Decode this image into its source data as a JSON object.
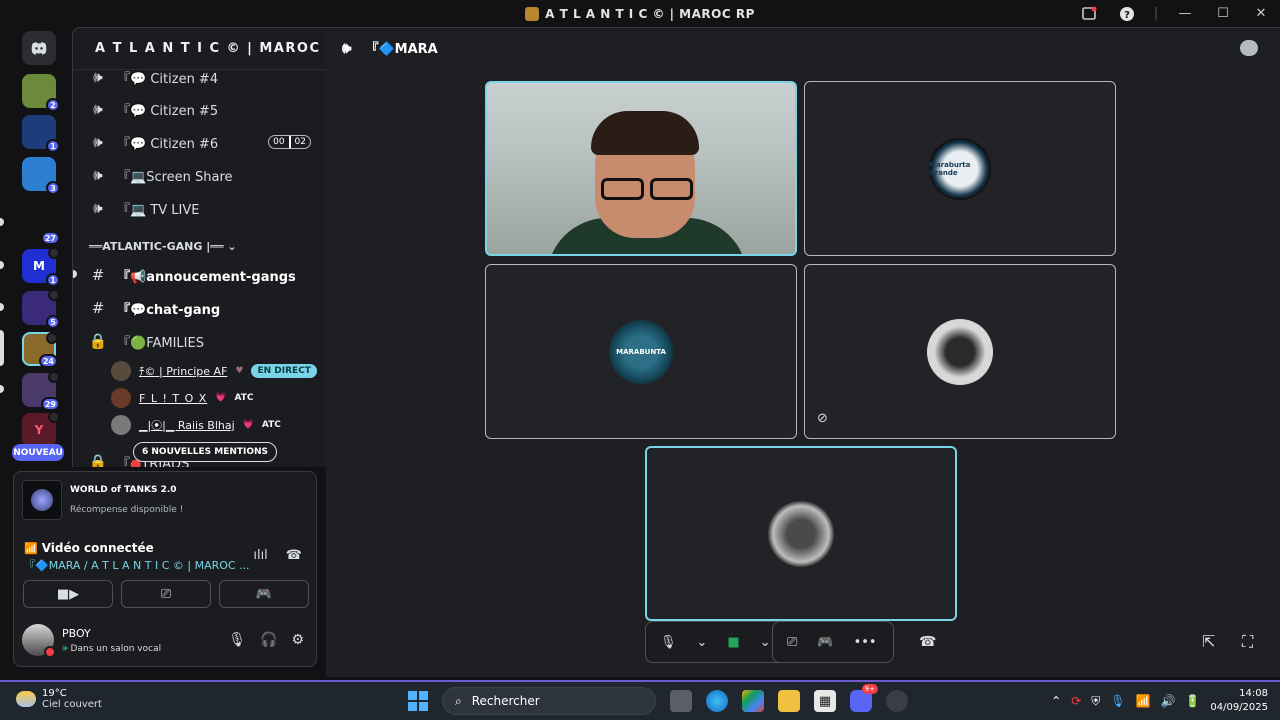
{
  "window": {
    "title": "A T L A N T I C © | MAROC RP"
  },
  "rail": {
    "servers": [
      {
        "badge": ""
      },
      {
        "badge": "2"
      },
      {
        "badge": "1"
      },
      {
        "badge": "3"
      },
      {
        "badge": "27"
      },
      {
        "badge": "1"
      },
      {
        "badge": "5"
      },
      {
        "badge": "24"
      },
      {
        "badge": "29"
      },
      {
        "badge": ""
      }
    ],
    "new_label": "NOUVEAU"
  },
  "guild": {
    "name": "A T L A N T I C © | MAROC RP"
  },
  "channels": [
    {
      "prefix": "『",
      "name": "Citizen #4",
      "icon": "💬"
    },
    {
      "prefix": "『",
      "name": "Citizen #5",
      "icon": "💬"
    },
    {
      "prefix": "『",
      "name": "Citizen #6",
      "icon": "💬",
      "usage": [
        "00",
        "02"
      ]
    },
    {
      "prefix": "『",
      "name": "Screen Share",
      "icon": "💻"
    },
    {
      "prefix": "『",
      "name": "TV LIVE",
      "icon": "💻"
    }
  ],
  "category": "══ATLANTIC-GANG |══ ⌄",
  "gang_channels": [
    {
      "prefix": "『",
      "name": "annoucement-gangs",
      "icon": "📢"
    },
    {
      "prefix": "『",
      "name": "chat-gang",
      "icon": "💬"
    },
    {
      "prefix": "『",
      "name": "FAMILIES",
      "icon": "🟢"
    }
  ],
  "members": [
    {
      "name": "ﾁ© | Principe AF",
      "extra": "",
      "live": "EN DIRECT"
    },
    {
      "name": "F L ! T O X",
      "extra": "ATC",
      "live": ""
    },
    {
      "name": "▁|⦿|▁ Raiis Blhaj",
      "extra": "ATC",
      "live": ""
    }
  ],
  "triads_channel": {
    "prefix": "『",
    "name": "TRIADS"
  },
  "mentions": "6 NOUVELLES MENTIONS",
  "promo": {
    "title": "WORLD of TANKS 2.0",
    "subtitle": "Récompense disponible !"
  },
  "voice": {
    "status": "Vidéo connectée",
    "channel": "『🔷MARA / A T L A N T I C © | MAROC ..."
  },
  "user": {
    "name": "PBOY",
    "status": "Dans un salon vocal"
  },
  "main": {
    "channel": "『🔷MARA"
  },
  "tiles": [
    {
      "label": "Maraburta Grande"
    },
    {
      "label": "MARABUNTA"
    }
  ],
  "taskbar": {
    "temp": "19°C",
    "weather": "Ciel couvert",
    "search": "Rechercher",
    "time": "14:08",
    "date": "04/09/2025",
    "discord_badge": "9+"
  },
  "colors": {
    "accent": "#5865f2",
    "speaking": "#7ad4e8",
    "danger": "#f23f43",
    "live": "#7ad4e8"
  }
}
